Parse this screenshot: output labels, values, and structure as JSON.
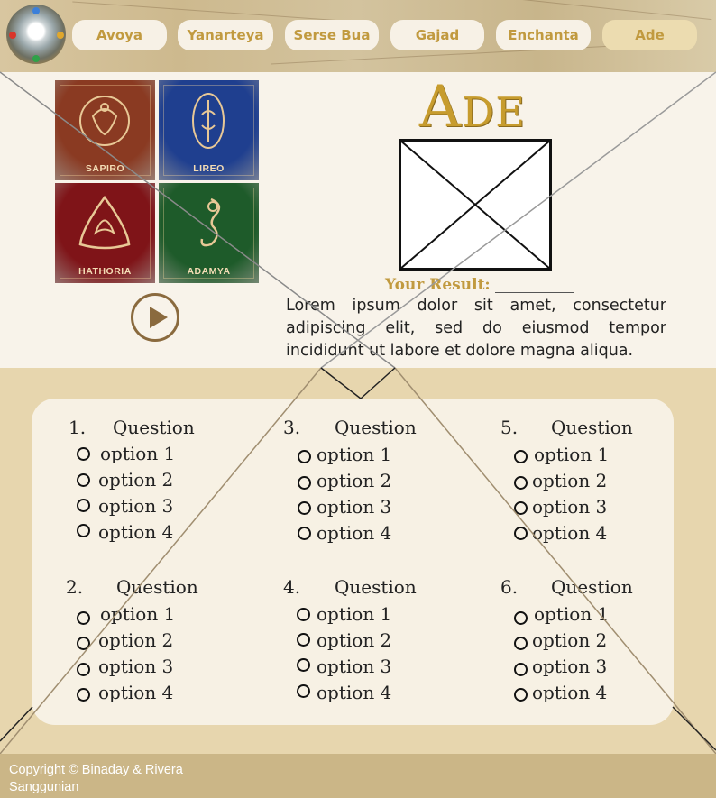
{
  "nav": {
    "items": [
      "Avoya",
      "Yanarteya",
      "Serse Bua",
      "Gajad",
      "Enchanta",
      "Ade"
    ],
    "active": "Ade"
  },
  "cards": [
    {
      "label": "SAPIRO",
      "color": "#8a3a22",
      "icon": "sapiro-emblem-icon"
    },
    {
      "label": "LIREO",
      "color": "#1f3f8f",
      "icon": "lireo-emblem-icon"
    },
    {
      "label": "HATHORIA",
      "color": "#7f1418",
      "icon": "hathoria-emblem-icon"
    },
    {
      "label": "ADAMYA",
      "color": "#1e5b2a",
      "icon": "adamya-emblem-icon"
    }
  ],
  "hero": {
    "title": "Ade",
    "result_label": "Your Result:",
    "description": "Lorem ipsum dolor sit amet, consectetur adipiscing elit, sed do eiusmod tempor incididunt ut labore et dolore magna aliqua."
  },
  "questions": [
    {
      "number": "1.",
      "text": "Question",
      "options": [
        "option 1",
        "option 2",
        "option 3",
        "option 4"
      ]
    },
    {
      "number": "2.",
      "text": "Question",
      "options": [
        "option 1",
        "option 2",
        "option 3",
        "option 4"
      ]
    },
    {
      "number": "3.",
      "text": "Question",
      "options": [
        "option 1",
        "option 2",
        "option 3",
        "option 4"
      ]
    },
    {
      "number": "4.",
      "text": "Question",
      "options": [
        "option 1",
        "option 2",
        "option 3",
        "option 4"
      ]
    },
    {
      "number": "5.",
      "text": "Question",
      "options": [
        "option 1",
        "option 2",
        "option 3",
        "option 4"
      ]
    },
    {
      "number": "6.",
      "text": "Question",
      "options": [
        "option 1",
        "option 2",
        "option 3",
        "option 4"
      ]
    }
  ],
  "footer": {
    "copyright": "Copyright © Binaday & Rivera Sanggunian"
  },
  "colors": {
    "gold": "#c19a3f",
    "cream": "#f8f3ea",
    "tan": "#e7d6ae",
    "footer": "#cbb687"
  }
}
